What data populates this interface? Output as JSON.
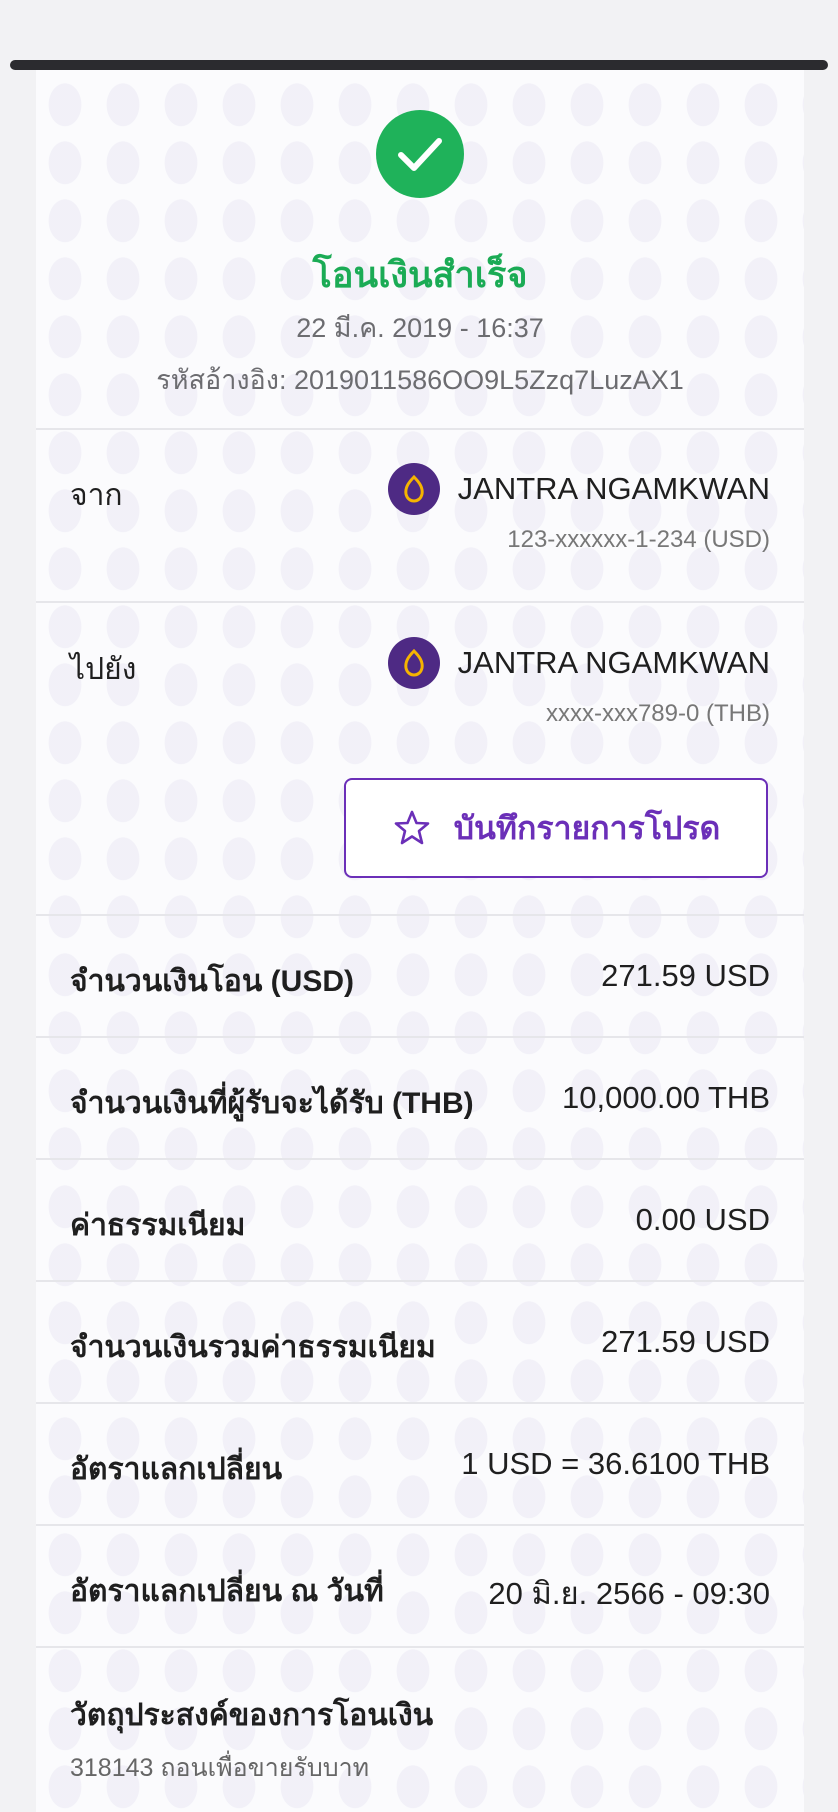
{
  "header": {
    "status_title": "โอนเงินสำเร็จ",
    "datetime": "22 มี.ค. 2019 - 16:37",
    "reference": "รหัสอ้างอิง: 2019011586OO9L5Zzq7LuzAX1",
    "check_icon": "check-icon",
    "success_color": "#1FB25A"
  },
  "from": {
    "label": "จาก",
    "name": "JANTRA NGAMKWAN",
    "account": "123-xxxxxx-1-234 (USD)",
    "bank_icon": "bank-logo-icon"
  },
  "to": {
    "label": "ไปยัง",
    "name": "JANTRA NGAMKWAN",
    "account": "xxxx-xxx789-0 (THB)",
    "bank_icon": "bank-logo-icon"
  },
  "favorite_button": {
    "label": "บันทึกรายการโปรด",
    "icon": "star-icon",
    "accent": "#6B2FB8"
  },
  "details": [
    {
      "label": "จำนวนเงินโอน (USD)",
      "value": "271.59 USD"
    },
    {
      "label": "จำนวนเงินที่ผู้รับจะได้รับ (THB)",
      "value": "10,000.00 THB"
    },
    {
      "label": "ค่าธรรมเนียม",
      "value": "0.00 USD"
    },
    {
      "label": "จำนวนเงินรวมค่าธรรมเนียม",
      "value": "271.59 USD"
    },
    {
      "label": "อัตราแลกเปลี่ยน",
      "value": "1 USD = 36.6100 THB"
    },
    {
      "label": "อัตราแลกเปลี่ยน ณ วันที่",
      "value": "20 มิ.ย. 2566 - 09:30"
    }
  ],
  "purpose": {
    "label": "วัตถุประสงค์ของการโอนเงิน",
    "value": "318143 ถอนเพื่อขายรับบาท"
  }
}
